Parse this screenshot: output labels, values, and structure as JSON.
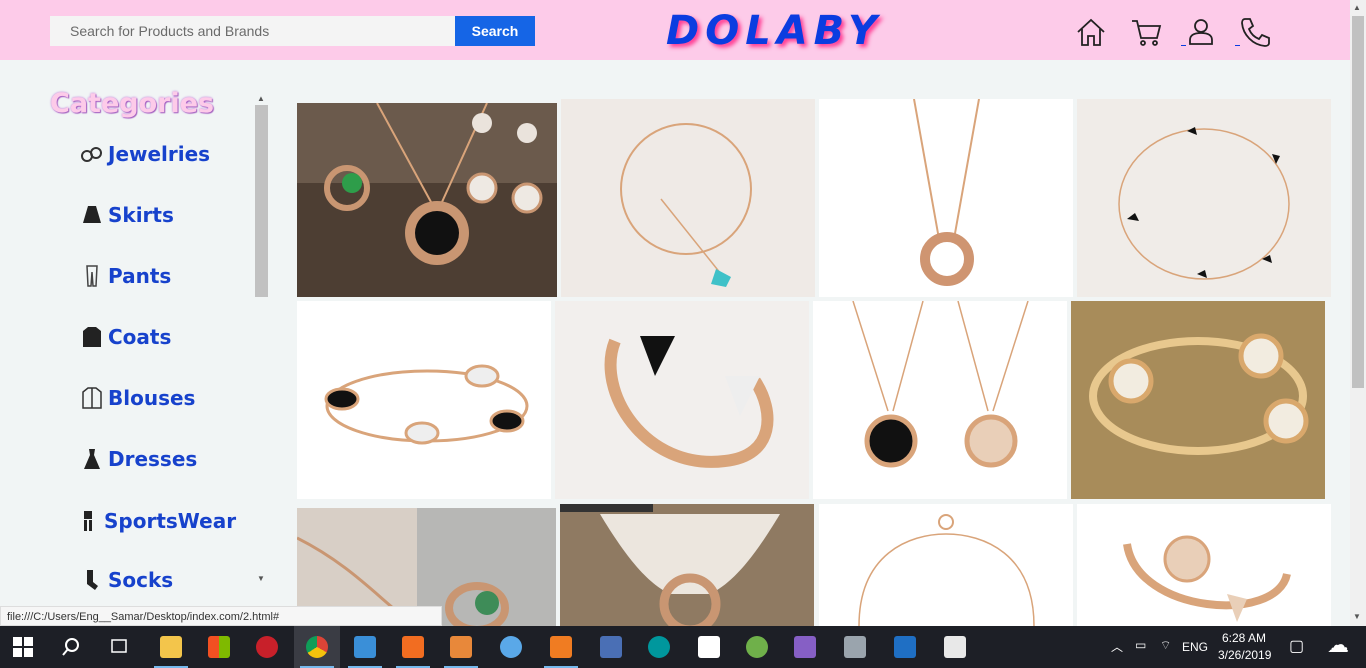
{
  "header": {
    "search_placeholder": "Search for Products and Brands",
    "search_button": "Search",
    "logo": "DOLABY",
    "icons": [
      "home-icon",
      "cart-icon",
      "user-icon",
      "phone-icon"
    ]
  },
  "sidebar": {
    "title": "Categories",
    "items": [
      {
        "label": "Jewelries",
        "icon": "rings-icon"
      },
      {
        "label": "Skirts",
        "icon": "skirt-icon"
      },
      {
        "label": "Pants",
        "icon": "pants-icon"
      },
      {
        "label": "Coats",
        "icon": "coat-icon"
      },
      {
        "label": "Blouses",
        "icon": "blouse-icon"
      },
      {
        "label": "Dresses",
        "icon": "dress-icon"
      },
      {
        "label": "SportsWear",
        "icon": "sportswear-icon"
      },
      {
        "label": "Socks",
        "icon": "sock-icon"
      }
    ]
  },
  "products": [
    "jewelry-set-photo",
    "bracelet-photo",
    "ring-pendant-photo",
    "chain-bracelet-photo",
    "black-stone-bracelet-photo",
    "open-bangle-photo",
    "pendant-necklaces-photo",
    "gold-bracelet-photo",
    "necklace-ring-photo",
    "ring-pendant-display-photo",
    "chain-bracelet-2-photo",
    "flower-bangle-photo"
  ],
  "status_bar": "file:///C:/Users/Eng__Samar/Desktop/index.com/2.html#",
  "taskbar": {
    "language": "ENG",
    "time": "6:28 AM",
    "date": "3/26/2019"
  },
  "colors": {
    "header_bg": "#fdcbe9",
    "accent": "#1565e6",
    "category_text": "#1742cc"
  }
}
